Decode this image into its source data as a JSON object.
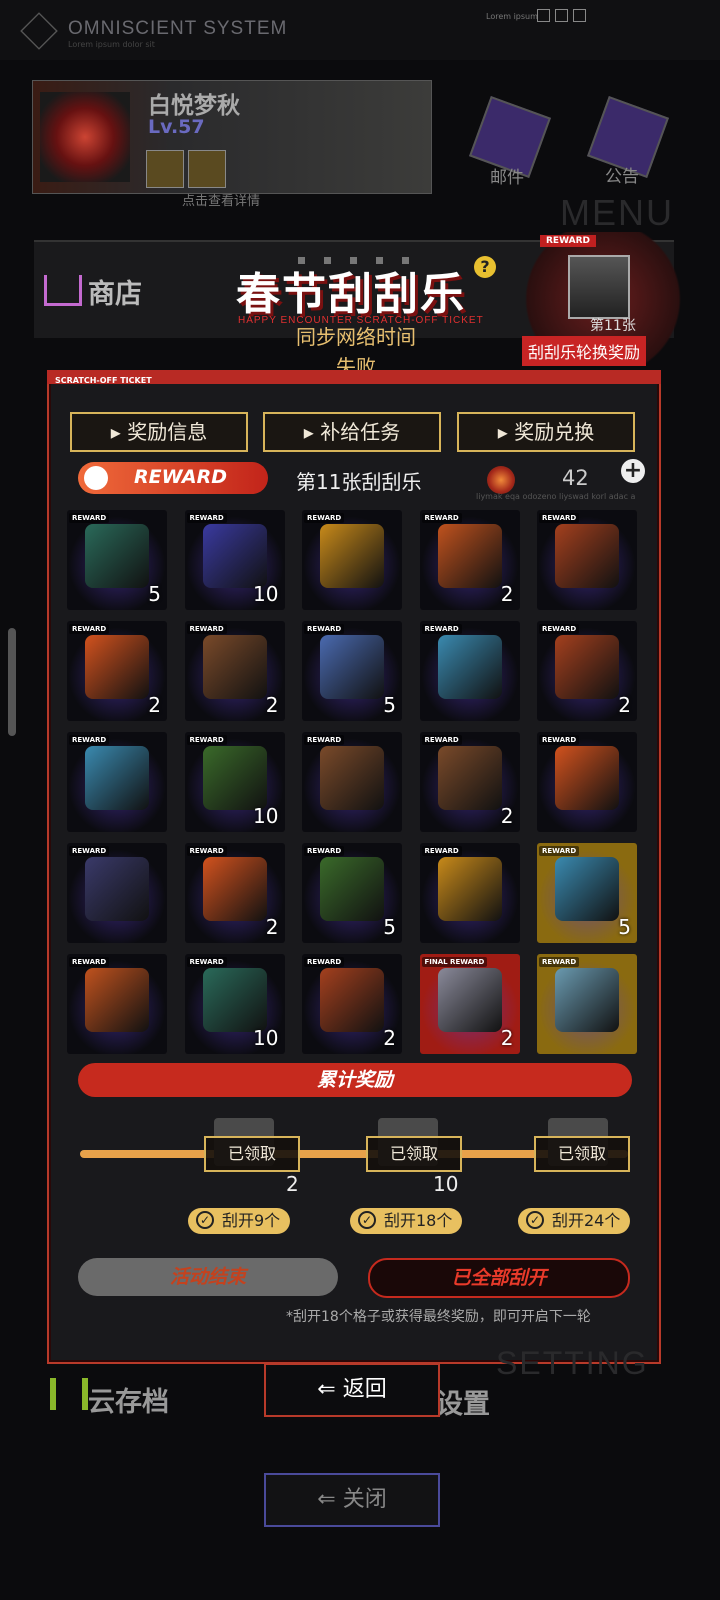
{
  "header": {
    "system_title": "OMNISCIENT SYSTEM",
    "system_subtitle": "Lorem ipsum dolor sit",
    "top_right_text": "Lorem ipsum"
  },
  "profile": {
    "name": "白悦梦秋",
    "level": "Lv.57",
    "detail_hint": "点击查看详情"
  },
  "top_buttons": {
    "mail": "邮件",
    "notice": "公告",
    "menu_ghost": "MENU"
  },
  "shop": {
    "label": "商店"
  },
  "event": {
    "title": "春节刮刮乐",
    "help_icon": "?",
    "subtitle": "HAPPY ENCOUNTER SCRATCH-OFF TICKET",
    "sync_error": "同步网络时间失败",
    "rotation_reward_tag": "REWARD",
    "rotation_count": "第11张",
    "rotation_label": "刮刮乐轮换奖励"
  },
  "panel": {
    "header_tag": "SCRATCH-OFF TICKET",
    "tabs": [
      "奖励信息",
      "补给任务",
      "奖励兑换"
    ],
    "reward_pill": "REWARD",
    "ticket_title": "第11张刮刮乐",
    "currency_value": "42",
    "plus_icon": "+",
    "code_text": "liymak eqa odozeno liyswad korl adac a"
  },
  "grid": [
    {
      "tag": "REWARD",
      "item": "hologram-mask",
      "count": "5",
      "style": "normal",
      "color": "#2a6a5a"
    },
    {
      "tag": "REWARD",
      "item": "data-card",
      "count": "10",
      "style": "normal",
      "color": "#3a3aa0"
    },
    {
      "tag": "REWARD",
      "item": "mystery-box",
      "count": "",
      "style": "normal",
      "color": "#c88a1a"
    },
    {
      "tag": "REWARD",
      "item": "supply-pack",
      "count": "2",
      "style": "normal",
      "color": "#c0521e"
    },
    {
      "tag": "REWARD",
      "item": "firecracker",
      "count": "",
      "style": "normal",
      "color": "#a4401e"
    },
    {
      "tag": "REWARD",
      "item": "red-envelopes",
      "count": "2",
      "style": "normal",
      "color": "#d2521e"
    },
    {
      "tag": "REWARD",
      "item": "dumpling-crate",
      "count": "2",
      "style": "normal",
      "color": "#7a4a2a"
    },
    {
      "tag": "REWARD",
      "item": "data-card",
      "count": "5",
      "style": "normal",
      "color": "#4a6ab0"
    },
    {
      "tag": "REWARD",
      "item": "core-ring",
      "count": "",
      "style": "normal",
      "color": "#3a8ab0"
    },
    {
      "tag": "REWARD",
      "item": "firecracker",
      "count": "2",
      "style": "normal",
      "color": "#a4401e"
    },
    {
      "tag": "REWARD",
      "item": "core-ring",
      "count": "",
      "style": "normal",
      "color": "#3a8ab0"
    },
    {
      "tag": "REWARD",
      "item": "pyramid-chip",
      "count": "10",
      "style": "normal",
      "color": "#3a6a2a"
    },
    {
      "tag": "REWARD",
      "item": "dumpling-crate",
      "count": "",
      "style": "normal",
      "color": "#7a4a2a"
    },
    {
      "tag": "REWARD",
      "item": "dumpling-crate",
      "count": "2",
      "style": "normal",
      "color": "#7a4a2a"
    },
    {
      "tag": "REWARD",
      "item": "red-envelopes",
      "count": "",
      "style": "normal",
      "color": "#d2521e"
    },
    {
      "tag": "REWARD",
      "item": "circuit-chip",
      "count": "",
      "style": "normal",
      "color": "#3a3a6a"
    },
    {
      "tag": "REWARD",
      "item": "red-envelopes",
      "count": "2",
      "style": "normal",
      "color": "#d2521e"
    },
    {
      "tag": "REWARD",
      "item": "pyramid-chip",
      "count": "5",
      "style": "normal",
      "color": "#3a6a2a"
    },
    {
      "tag": "REWARD",
      "item": "mystery-box",
      "count": "",
      "style": "normal",
      "color": "#c88a1a"
    },
    {
      "tag": "REWARD",
      "item": "core-ring",
      "count": "5",
      "style": "gold",
      "color": "#3a8ab0"
    },
    {
      "tag": "REWARD",
      "item": "supply-pack",
      "count": "",
      "style": "normal",
      "color": "#c0521e"
    },
    {
      "tag": "REWARD",
      "item": "hologram-mask",
      "count": "10",
      "style": "normal",
      "color": "#2a6a5a"
    },
    {
      "tag": "REWARD",
      "item": "firecracker",
      "count": "2",
      "style": "normal",
      "color": "#a4401e"
    },
    {
      "tag": "FINAL REWARD",
      "item": "imprimer-ticket",
      "count": "2",
      "style": "final",
      "color": "#8a8a9a"
    },
    {
      "tag": "REWARD",
      "item": "crystal-shard",
      "count": "",
      "style": "gold",
      "color": "#6a9ab0"
    }
  ],
  "cumulative": {
    "title": "累计奖励",
    "milestones": [
      {
        "claim": "已领取",
        "count": "2",
        "condition": "刮开9个"
      },
      {
        "claim": "已领取",
        "count": "10",
        "condition": "刮开18个"
      },
      {
        "claim": "已领取",
        "count": "",
        "condition": "刮开24个"
      }
    ]
  },
  "actions": {
    "ended": "活动结束",
    "all_scratched": "已全部刮开",
    "note": "*刮开18个格子或获得最终奖励，即可开启下一轮"
  },
  "bottom": {
    "cloud_save": "云存档",
    "setting_ghost": "SETTING",
    "setting": "设置",
    "back": "返回",
    "close": "关闭"
  }
}
